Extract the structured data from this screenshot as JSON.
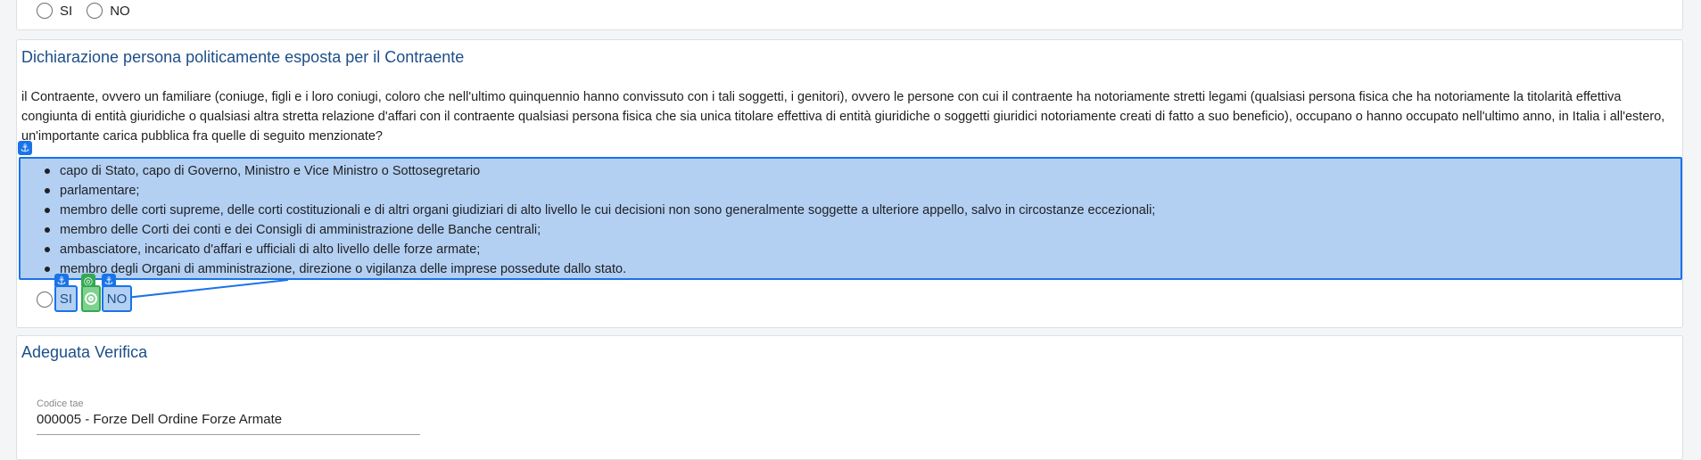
{
  "top_question": {
    "options": [
      "SI",
      "NO"
    ]
  },
  "pep_section": {
    "title": "Dichiarazione persona politicamente esposta per il Contraente",
    "question": "il Contraente, ovvero un familiare (coniuge, figli e i loro coniugi, coloro che nell'ultimo quinquennio hanno convissuto con i tali soggetti, i genitori), ovvero le persone con cui il contraente ha notoriamente stretti legami (qualsiasi persona fisica che ha notoriamente la titolarità effettiva congiunta di entità giuridiche o qualsiasi altra stretta relazione d'affari con il contraente qualsiasi persona fisica che sia unica titolare effettiva di entità giuridiche o soggetti giuridici notoriamente creati di fatto a suo beneficio), occupano o hanno occupato nell'ultimo anno, in Italia i all'estero, un'importante carica pubblica fra quelle di seguito menzionate?",
    "items": [
      "capo di Stato, capo di Governo, Ministro e Vice Ministro o Sottosegretario",
      "parlamentare;",
      "membro delle corti supreme, delle corti costituzionali e di altri organi giudiziari di alto livello le cui decisioni non sono generalmente soggette a ulteriore appello, salvo in circostanze eccezionali;",
      "membro delle Corti dei conti e dei Consigli di amministrazione delle Banche centrali;",
      "ambasciatore, incaricato d'affari e ufficiali di alto livello delle forze armate;",
      "membro degli Organi di amministrazione, direzione o vigilanza delle imprese possedute dallo stato."
    ],
    "options": [
      "SI",
      "NO"
    ]
  },
  "verification_section": {
    "title": "Adeguata Verifica",
    "field_label": "Codice tae",
    "field_value": "000005 - Forze Dell Ordine Forze Armate"
  },
  "overlay": {
    "anchor_glyph": "⚓",
    "colors": {
      "anchor": "#1a73e8",
      "target": "#34a853",
      "highlight": "#b3d0f3"
    }
  }
}
